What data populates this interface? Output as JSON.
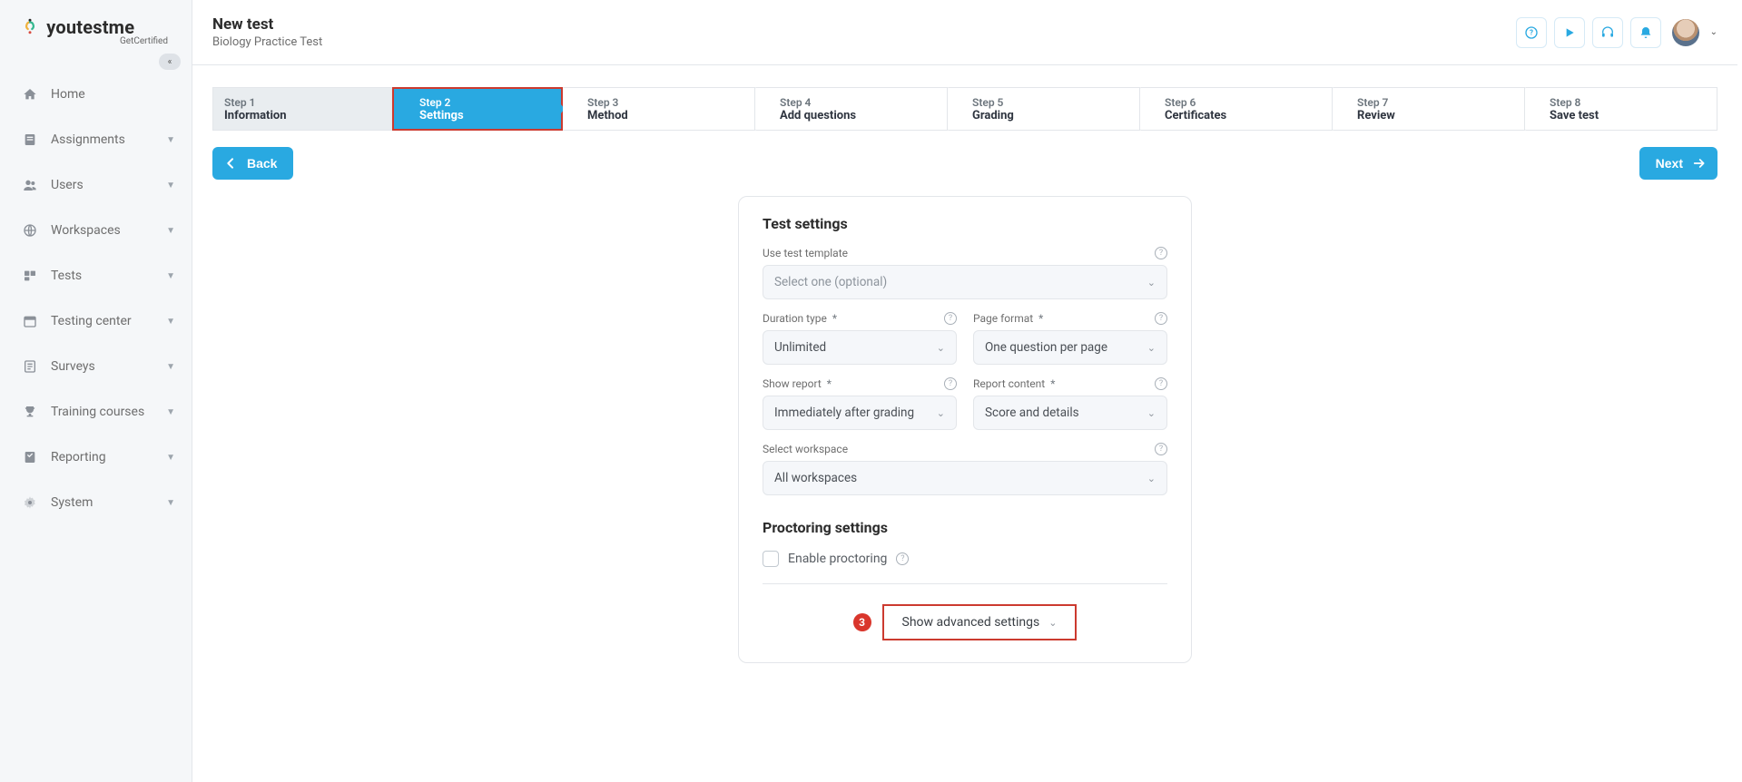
{
  "logo": {
    "brand": "youtestme",
    "sub": "GetCertified"
  },
  "sidebar": {
    "items": [
      {
        "label": "Home"
      },
      {
        "label": "Assignments"
      },
      {
        "label": "Users"
      },
      {
        "label": "Workspaces"
      },
      {
        "label": "Tests"
      },
      {
        "label": "Testing center"
      },
      {
        "label": "Surveys"
      },
      {
        "label": "Training courses"
      },
      {
        "label": "Reporting"
      },
      {
        "label": "System"
      }
    ]
  },
  "header": {
    "title": "New test",
    "subtitle": "Biology Practice Test"
  },
  "steps": [
    {
      "num": "Step 1",
      "label": "Information"
    },
    {
      "num": "Step 2",
      "label": "Settings"
    },
    {
      "num": "Step 3",
      "label": "Method"
    },
    {
      "num": "Step 4",
      "label": "Add questions"
    },
    {
      "num": "Step 5",
      "label": "Grading"
    },
    {
      "num": "Step 6",
      "label": "Certificates"
    },
    {
      "num": "Step 7",
      "label": "Review"
    },
    {
      "num": "Step 8",
      "label": "Save test"
    }
  ],
  "nav": {
    "back": "Back",
    "next": "Next"
  },
  "card": {
    "test_settings_heading": "Test settings",
    "template_label": "Use test template",
    "template_value": "Select one (optional)",
    "duration_label": "Duration type",
    "duration_value": "Unlimited",
    "page_format_label": "Page format",
    "page_format_value": "One question per page",
    "show_report_label": "Show report",
    "show_report_value": "Immediately after grading",
    "report_content_label": "Report content",
    "report_content_value": "Score and details",
    "workspace_label": "Select workspace",
    "workspace_value": "All workspaces",
    "proctoring_heading": "Proctoring settings",
    "enable_proctoring": "Enable proctoring",
    "advanced_badge": "3",
    "advanced_text": "Show advanced settings",
    "required_mark": "*"
  }
}
